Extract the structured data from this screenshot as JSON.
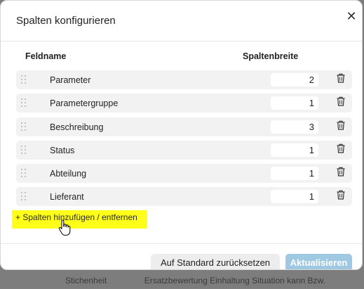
{
  "background": {
    "texts": [
      "Stichenheit",
      "Ersatzbewertung Einhaltung Situation kann Bzw."
    ]
  },
  "dialog": {
    "title": "Spalten konfigurieren",
    "close_glyph": "✕",
    "columns": {
      "name": "Feldname",
      "width": "Spaltenbreite"
    },
    "rows": [
      {
        "label": "Parameter",
        "width": "2"
      },
      {
        "label": "Parametergruppe",
        "width": "1"
      },
      {
        "label": "Beschreibung",
        "width": "3"
      },
      {
        "label": "Status",
        "width": "1"
      },
      {
        "label": "Abteilung",
        "width": "1"
      },
      {
        "label": "Lieferant",
        "width": "1"
      }
    ],
    "add_link": "+ Spalten hinzufügen / entfernen",
    "reset_button": "Auf Standard zurücksetzen",
    "update_button": "Aktualisieren"
  },
  "colors": {
    "highlight": "#ffff1a",
    "primary_button": "#9fc8e2",
    "row_background": "#f2f2f2"
  },
  "icons": [
    "close-icon",
    "drag-handle-icon",
    "trash-icon",
    "hand-pointer-icon"
  ]
}
